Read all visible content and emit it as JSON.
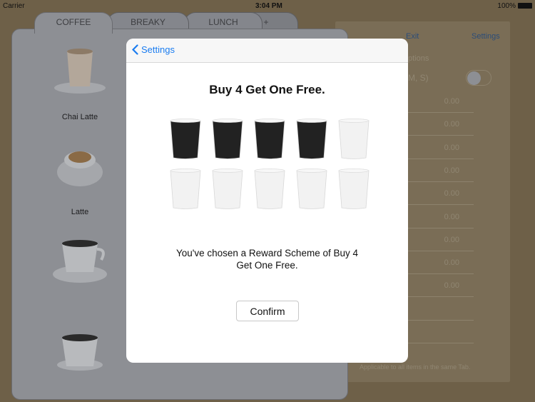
{
  "status_bar": {
    "carrier": "Carrier",
    "time": "3:04 PM",
    "battery": "100%"
  },
  "tabs": [
    {
      "label": "COFFEE"
    },
    {
      "label": "BREAKY"
    },
    {
      "label": "LUNCH"
    },
    {
      "label": "+"
    }
  ],
  "menu_items": [
    {
      "label": "Chai Latte"
    },
    {
      "label": "Latte"
    },
    {
      "label": ""
    },
    {
      "label": ""
    }
  ],
  "settings_panel": {
    "exit": "Exit",
    "settings": "Settings",
    "section_partial": "ptions",
    "sizes_partial": "M, S)",
    "size_toggle_on": false,
    "prices": [
      "0.00",
      "0.00",
      "0.00",
      "0.00",
      "0.00",
      "0.00",
      "0.00",
      "0.00",
      "0.00"
    ],
    "footer": "Applicable to all items in the same Tab."
  },
  "modal": {
    "back_label": "Settings",
    "title": "Buy 4 Get One Free.",
    "cups": {
      "total": 10,
      "filled": 4
    },
    "message": "You've chosen a Reward Scheme of Buy 4 Get One Free.",
    "confirm_label": "Confirm"
  },
  "colors": {
    "accent": "#1a7cf0",
    "cup_filled": "#222222",
    "cup_empty": "#f2f2f2"
  }
}
